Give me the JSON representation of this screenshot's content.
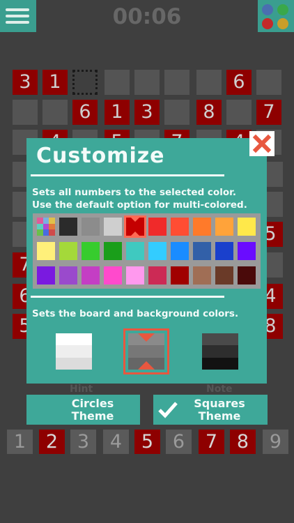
{
  "header": {
    "timer": "00:06"
  },
  "board": {
    "row1": [
      "3",
      "1",
      "",
      "",
      "",
      "",
      "",
      "6",
      ""
    ],
    "row2": [
      "",
      "",
      "6",
      "1",
      "3",
      "",
      "8",
      "",
      "7"
    ],
    "row3_visible": [
      "",
      "4",
      "",
      "5",
      "",
      "7",
      "",
      "4",
      ""
    ]
  },
  "modal": {
    "title": "Customize",
    "desc_numbers_line1": "Sets all numbers to the selected color.",
    "desc_numbers_line2": "Use the default option for multi-colored.",
    "desc_board": "Sets the board and background colors.",
    "selected_color": "#c40000",
    "palette": [
      [
        "multi",
        "#2b2b2b",
        "#8c8c8c",
        "#cfcfcf",
        "#c40000",
        "#f02a2a",
        "#ff4d33",
        "#ff7a2a",
        "#ffa33a",
        "#ffe84a"
      ],
      [
        "#fff07a",
        "#a4d93a",
        "#37cc2e",
        "#1a9e1a",
        "#3fc9c0",
        "#33ccff",
        "#1a8cff",
        "#3260a8",
        "#1a40cc",
        "#6a0cff"
      ],
      [
        "#7a1ae0",
        "#9a4acc",
        "#c43ec4",
        "#ff4acc",
        "#ff99ee",
        "#cc2a55",
        "#a00000",
        "#a06e55",
        "#6a3a28",
        "#4a0a0a"
      ]
    ],
    "board_options": [
      "light",
      "gray",
      "dark"
    ],
    "selected_board_option": "gray"
  },
  "hint_label": "Hint",
  "note_label": "Note",
  "theme_buttons": {
    "circles": {
      "line1": "Circles",
      "line2": "Theme"
    },
    "squares": {
      "line1": "Squares",
      "line2": "Theme"
    }
  },
  "number_strip": [
    "1",
    "2",
    "3",
    "4",
    "5",
    "6",
    "7",
    "8",
    "9"
  ],
  "number_strip_highlighted": [
    "2",
    "5",
    "7",
    "8"
  ]
}
